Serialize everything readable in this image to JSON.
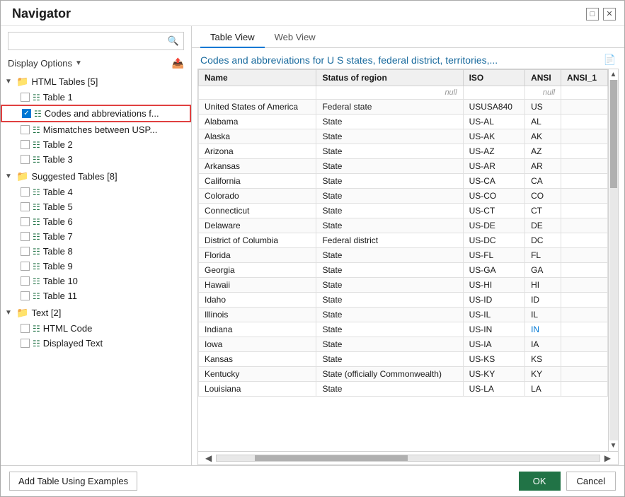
{
  "dialog": {
    "title": "Navigator",
    "min_label": "minimize",
    "close_label": "close"
  },
  "search": {
    "placeholder": ""
  },
  "display_options": {
    "label": "Display Options",
    "arrow": "▼"
  },
  "tree": {
    "html_tables": {
      "label": "HTML Tables [5]",
      "items": [
        {
          "id": "t1",
          "label": "Table 1",
          "checked": false
        },
        {
          "id": "t2",
          "label": "Codes and abbreviations f...",
          "checked": true,
          "selected": true
        },
        {
          "id": "t3",
          "label": "Mismatches between USP...",
          "checked": false
        },
        {
          "id": "t4",
          "label": "Table 2",
          "checked": false
        },
        {
          "id": "t5",
          "label": "Table 3",
          "checked": false
        }
      ]
    },
    "suggested_tables": {
      "label": "Suggested Tables [8]",
      "items": [
        {
          "id": "s1",
          "label": "Table 4",
          "checked": false
        },
        {
          "id": "s2",
          "label": "Table 5",
          "checked": false
        },
        {
          "id": "s3",
          "label": "Table 6",
          "checked": false
        },
        {
          "id": "s4",
          "label": "Table 7",
          "checked": false
        },
        {
          "id": "s5",
          "label": "Table 8",
          "checked": false
        },
        {
          "id": "s6",
          "label": "Table 9",
          "checked": false
        },
        {
          "id": "s7",
          "label": "Table 10",
          "checked": false
        },
        {
          "id": "s8",
          "label": "Table 11",
          "checked": false
        }
      ]
    },
    "text": {
      "label": "Text [2]",
      "items": [
        {
          "id": "tx1",
          "label": "HTML Code",
          "type": "text"
        },
        {
          "id": "tx2",
          "label": "Displayed Text",
          "type": "text"
        }
      ]
    }
  },
  "tabs": [
    {
      "id": "table-view",
      "label": "Table View",
      "active": true
    },
    {
      "id": "web-view",
      "label": "Web View",
      "active": false
    }
  ],
  "preview": {
    "title": "Codes and abbreviations for U S states, federal district, territories,..."
  },
  "table": {
    "headers": [
      "Name",
      "Status of region",
      "ISO",
      "ANSI",
      "ANSI_1"
    ],
    "null_row": [
      "",
      "null",
      "",
      "null",
      ""
    ],
    "rows": [
      [
        "United States of America",
        "Federal state",
        "USUSA840",
        "US",
        ""
      ],
      [
        "Alabama",
        "State",
        "US-AL",
        "AL",
        ""
      ],
      [
        "Alaska",
        "State",
        "US-AK",
        "AK",
        ""
      ],
      [
        "Arizona",
        "State",
        "US-AZ",
        "AZ",
        ""
      ],
      [
        "Arkansas",
        "State",
        "US-AR",
        "AR",
        ""
      ],
      [
        "California",
        "State",
        "US-CA",
        "CA",
        ""
      ],
      [
        "Colorado",
        "State",
        "US-CO",
        "CO",
        ""
      ],
      [
        "Connecticut",
        "State",
        "US-CT",
        "CT",
        ""
      ],
      [
        "Delaware",
        "State",
        "US-DE",
        "DE",
        ""
      ],
      [
        "District of Columbia",
        "Federal district",
        "US-DC",
        "DC",
        ""
      ],
      [
        "Florida",
        "State",
        "US-FL",
        "FL",
        ""
      ],
      [
        "Georgia",
        "State",
        "US-GA",
        "GA",
        ""
      ],
      [
        "Hawaii",
        "State",
        "US-HI",
        "HI",
        ""
      ],
      [
        "Idaho",
        "State",
        "US-ID",
        "ID",
        ""
      ],
      [
        "Illinois",
        "State",
        "US-IL",
        "IL",
        ""
      ],
      [
        "Indiana",
        "State",
        "US-IN",
        "IN",
        ""
      ],
      [
        "Iowa",
        "State",
        "US-IA",
        "IA",
        ""
      ],
      [
        "Kansas",
        "State",
        "US-KS",
        "KS",
        ""
      ],
      [
        "Kentucky",
        "State (officially Commonwealth)",
        "US-KY",
        "KY",
        ""
      ],
      [
        "Louisiana",
        "State",
        "US-LA",
        "LA",
        ""
      ]
    ]
  },
  "bottom": {
    "add_label": "Add Table Using Examples",
    "ok_label": "OK",
    "cancel_label": "Cancel"
  }
}
